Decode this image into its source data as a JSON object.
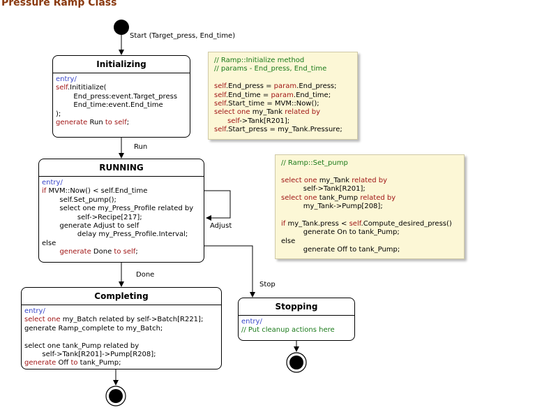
{
  "title": "Pressure Ramp Class",
  "transitions": {
    "start": "Start (Target_press, End_time)",
    "run": "Run",
    "adjust": "Adjust",
    "done": "Done",
    "stop": "Stop"
  },
  "states": {
    "initializing": {
      "name": "Initializing",
      "lines": [
        [
          {
            "c": "en",
            "t": "entry/"
          }
        ],
        [
          {
            "c": "kw",
            "t": "self"
          },
          {
            "c": "bk",
            "t": ".Inititialize("
          }
        ],
        [
          {
            "c": "bk",
            "t": "        End_press:event.Target_press"
          }
        ],
        [
          {
            "c": "bk",
            "t": "        End_time:event.End_time"
          }
        ],
        [
          {
            "c": "bk",
            "t": ");"
          }
        ],
        [
          {
            "c": "kw",
            "t": "generate "
          },
          {
            "c": "bk",
            "t": "Run "
          },
          {
            "c": "kw",
            "t": "to self"
          },
          {
            "c": "bk",
            "t": ";"
          }
        ]
      ]
    },
    "running": {
      "name": "RUNNING",
      "lines": [
        [
          {
            "c": "en",
            "t": "entry/"
          }
        ],
        [
          {
            "c": "kw",
            "t": "if "
          },
          {
            "c": "bk",
            "t": "MVM::Now() < self.End_time"
          }
        ],
        [
          {
            "c": "bk",
            "t": "        self.Set_pump();"
          }
        ],
        [
          {
            "c": "bk",
            "t": "        select one my_Press_Profile related by"
          }
        ],
        [
          {
            "c": "bk",
            "t": "                self->Recipe[217];"
          }
        ],
        [
          {
            "c": "bk",
            "t": "        generate Adjust to self"
          }
        ],
        [
          {
            "c": "bk",
            "t": "                delay my_Press_Profile.Interval;"
          }
        ],
        [
          {
            "c": "bk",
            "t": "else"
          }
        ],
        [
          {
            "c": "bk",
            "t": "        "
          },
          {
            "c": "kw",
            "t": "generate "
          },
          {
            "c": "bk",
            "t": "Done "
          },
          {
            "c": "kw",
            "t": "to self"
          },
          {
            "c": "bk",
            "t": ";"
          }
        ]
      ]
    },
    "completing": {
      "name": "Completing",
      "lines": [
        [
          {
            "c": "en",
            "t": "entry/"
          }
        ],
        [
          {
            "c": "kw",
            "t": "select one "
          },
          {
            "c": "bk",
            "t": "my_Batch related by self->Batch[R221];"
          }
        ],
        [
          {
            "c": "bk",
            "t": "generate Ramp_complete to my_Batch;"
          }
        ],
        [
          {
            "c": "bk",
            "t": " "
          }
        ],
        [
          {
            "c": "bk",
            "t": "select one tank_Pump related by"
          }
        ],
        [
          {
            "c": "bk",
            "t": "        self->Tank[R201]->Pump[R208];"
          }
        ],
        [
          {
            "c": "kw",
            "t": "generate "
          },
          {
            "c": "bk",
            "t": "Off "
          },
          {
            "c": "kw",
            "t": "to "
          },
          {
            "c": "bk",
            "t": "tank_Pump;"
          }
        ]
      ]
    },
    "stopping": {
      "name": "Stopping",
      "lines": [
        [
          {
            "c": "en",
            "t": "entry/"
          }
        ],
        [
          {
            "c": "cm",
            "t": "// Put cleanup actions here"
          }
        ]
      ]
    }
  },
  "notes": {
    "initialize": {
      "lines": [
        [
          {
            "c": "cm",
            "t": "// Ramp::Initialize method"
          }
        ],
        [
          {
            "c": "cm",
            "t": "// params - End_press, End_time"
          }
        ],
        [
          {
            "c": "bk",
            "t": " "
          }
        ],
        [
          {
            "c": "kw",
            "t": "self"
          },
          {
            "c": "bk",
            "t": ".End_press = "
          },
          {
            "c": "kw",
            "t": "param"
          },
          {
            "c": "bk",
            "t": ".End_press;"
          }
        ],
        [
          {
            "c": "kw",
            "t": "self"
          },
          {
            "c": "bk",
            "t": ".End_time = "
          },
          {
            "c": "kw",
            "t": "param"
          },
          {
            "c": "bk",
            "t": ".End_time;"
          }
        ],
        [
          {
            "c": "kw",
            "t": "self"
          },
          {
            "c": "bk",
            "t": ".Start_time = MVM::Now();"
          }
        ],
        [
          {
            "c": "kw",
            "t": "select one "
          },
          {
            "c": "bk",
            "t": "my_Tank "
          },
          {
            "c": "kw",
            "t": "related by"
          }
        ],
        [
          {
            "c": "bk",
            "t": "      "
          },
          {
            "c": "kw",
            "t": "self"
          },
          {
            "c": "bk",
            "t": "->Tank[R201];"
          }
        ],
        [
          {
            "c": "kw",
            "t": "self"
          },
          {
            "c": "bk",
            "t": ".Start_press = my_Tank.Pressure;"
          }
        ]
      ]
    },
    "set_pump": {
      "lines": [
        [
          {
            "c": "cm",
            "t": "// Ramp::Set_pump"
          }
        ],
        [
          {
            "c": "bk",
            "t": " "
          }
        ],
        [
          {
            "c": "kw",
            "t": "select one "
          },
          {
            "c": "bk",
            "t": "my_Tank "
          },
          {
            "c": "kw",
            "t": "related by"
          }
        ],
        [
          {
            "c": "bk",
            "t": "          self->Tank[R201];"
          }
        ],
        [
          {
            "c": "kw",
            "t": "select one "
          },
          {
            "c": "bk",
            "t": "tank_Pump "
          },
          {
            "c": "kw",
            "t": "related by"
          }
        ],
        [
          {
            "c": "bk",
            "t": "          my_Tank->Pump[208];"
          }
        ],
        [
          {
            "c": "bk",
            "t": " "
          }
        ],
        [
          {
            "c": "kw",
            "t": "if "
          },
          {
            "c": "bk",
            "t": "my_Tank.press < "
          },
          {
            "c": "kw",
            "t": "self"
          },
          {
            "c": "bk",
            "t": ".Compute_desired_press()"
          }
        ],
        [
          {
            "c": "bk",
            "t": "          generate On to tank_Pump;"
          }
        ],
        [
          {
            "c": "bk",
            "t": "else"
          }
        ],
        [
          {
            "c": "bk",
            "t": "          generate Off to tank_Pump;"
          }
        ]
      ]
    }
  }
}
